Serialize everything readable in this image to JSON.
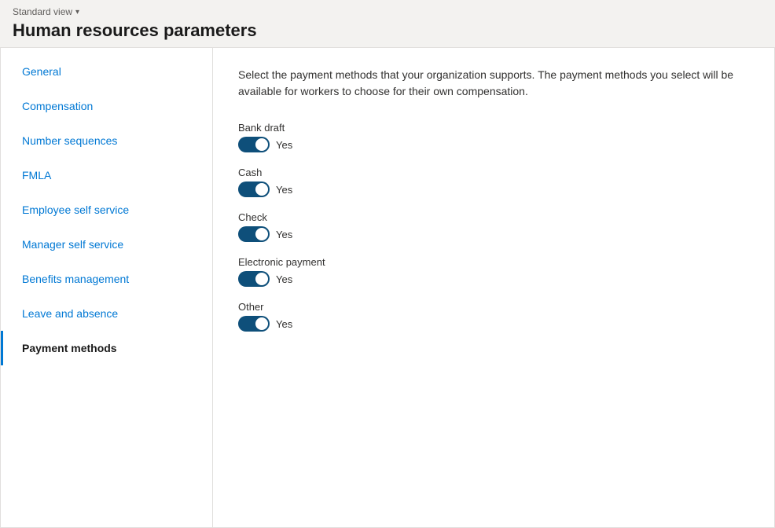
{
  "header": {
    "standard_view_label": "Standard view",
    "chevron": "▾",
    "page_title": "Human resources parameters"
  },
  "sidebar": {
    "items": [
      {
        "id": "general",
        "label": "General",
        "active": false
      },
      {
        "id": "compensation",
        "label": "Compensation",
        "active": false
      },
      {
        "id": "number-sequences",
        "label": "Number sequences",
        "active": false
      },
      {
        "id": "fmla",
        "label": "FMLA",
        "active": false
      },
      {
        "id": "employee-self-service",
        "label": "Employee self service",
        "active": false
      },
      {
        "id": "manager-self-service",
        "label": "Manager self service",
        "active": false
      },
      {
        "id": "benefits-management",
        "label": "Benefits management",
        "active": false
      },
      {
        "id": "leave-and-absence",
        "label": "Leave and absence",
        "active": false
      },
      {
        "id": "payment-methods",
        "label": "Payment methods",
        "active": true
      }
    ]
  },
  "main": {
    "description": "Select the payment methods that your organization supports. The payment methods you select will be available for workers to choose for their own compensation.",
    "payment_methods": [
      {
        "id": "bank-draft",
        "label": "Bank draft",
        "enabled": true,
        "yes_label": "Yes"
      },
      {
        "id": "cash",
        "label": "Cash",
        "enabled": true,
        "yes_label": "Yes"
      },
      {
        "id": "check",
        "label": "Check",
        "enabled": true,
        "yes_label": "Yes"
      },
      {
        "id": "electronic-payment",
        "label": "Electronic payment",
        "enabled": true,
        "yes_label": "Yes"
      },
      {
        "id": "other",
        "label": "Other",
        "enabled": true,
        "yes_label": "Yes"
      }
    ]
  }
}
